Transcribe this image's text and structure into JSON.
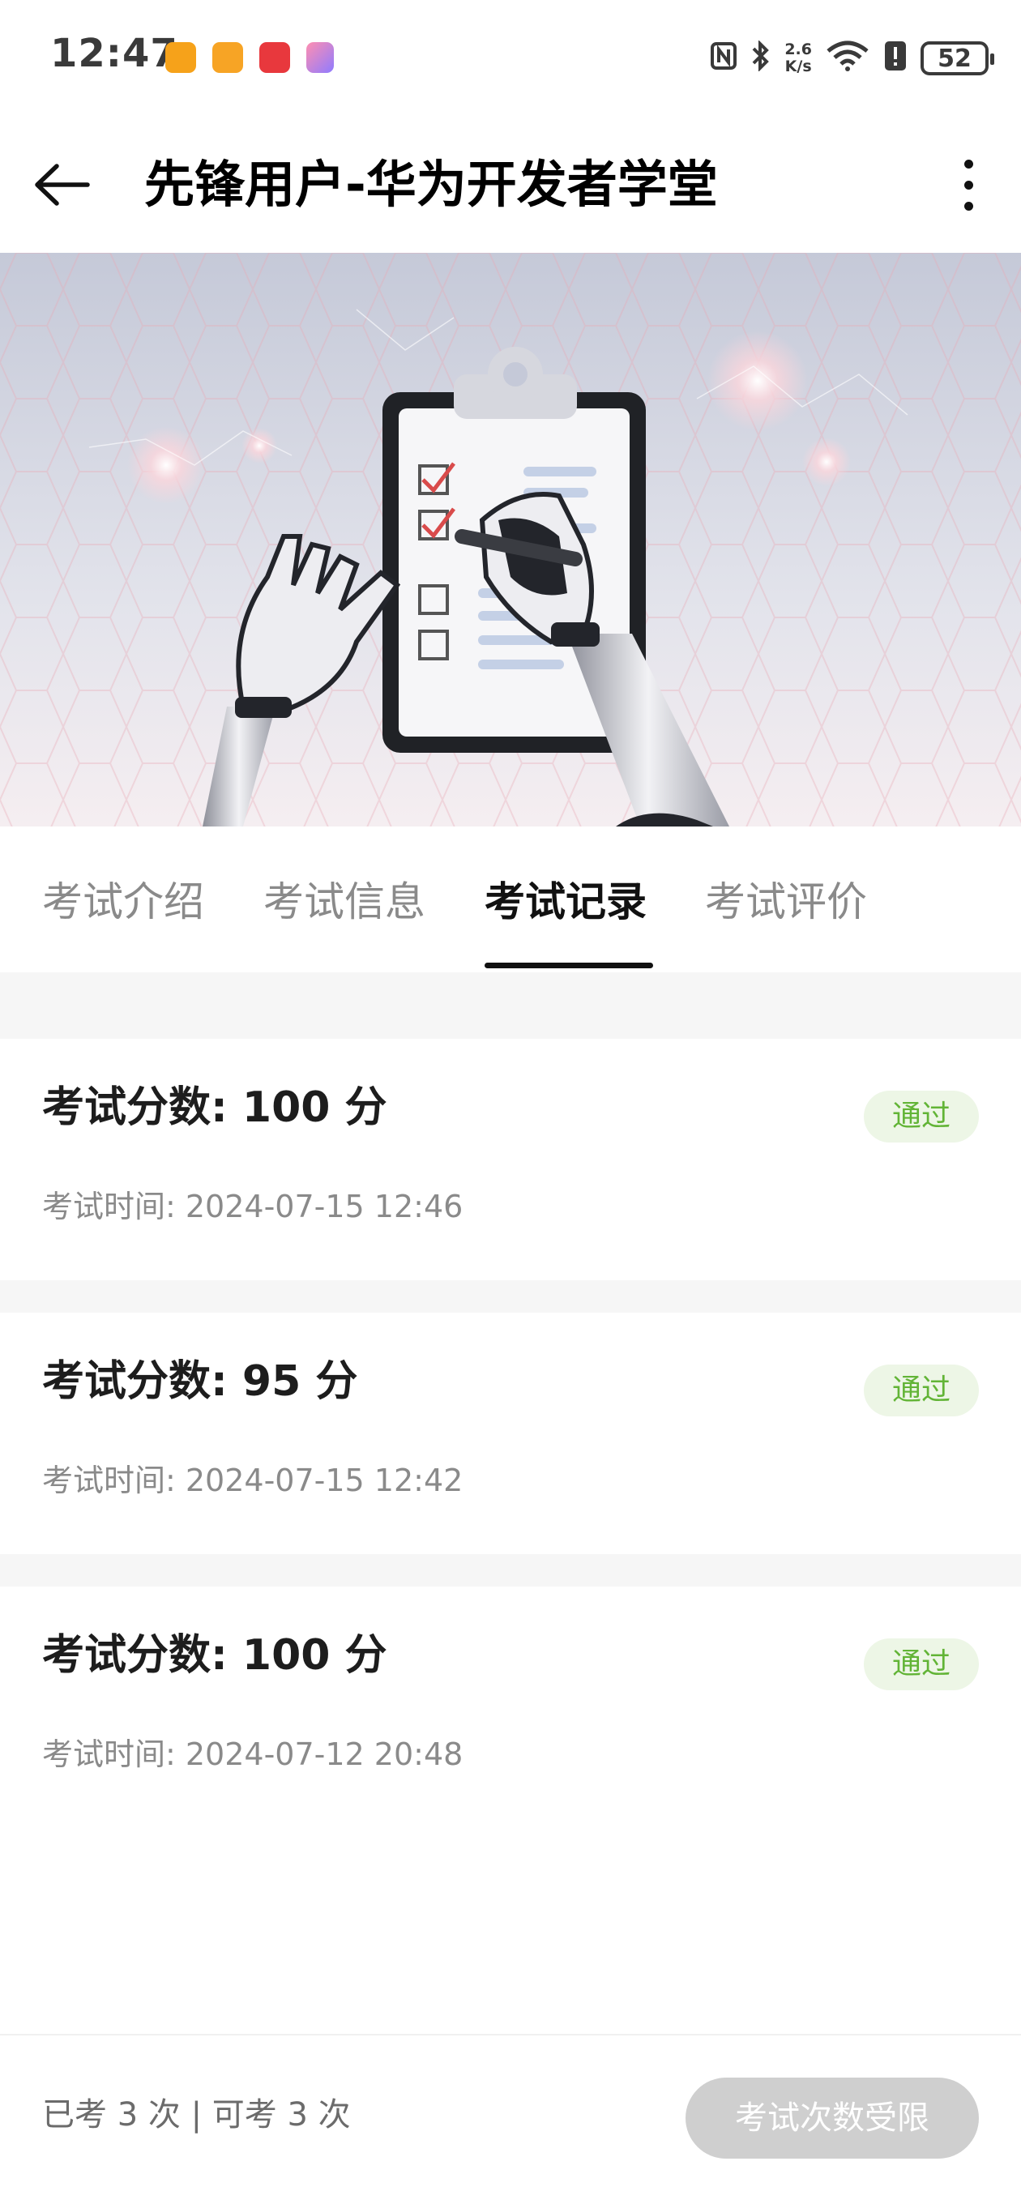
{
  "status_bar": {
    "time": "12:47",
    "net_speed_value": "2.6",
    "net_speed_unit": "K/s",
    "battery": "52",
    "icons": [
      "nfc-icon",
      "bluetooth-icon",
      "wifi-6-icon",
      "battery-alert-icon"
    ]
  },
  "header": {
    "title": "先锋用户-华为开发者学堂"
  },
  "tabs": [
    {
      "label": "考试介绍"
    },
    {
      "label": "考试信息"
    },
    {
      "label": "考试记录"
    },
    {
      "label": "考试评价"
    }
  ],
  "active_tab": "考试记录",
  "records": [
    {
      "score": "考试分数: 100 分",
      "time": "考试时间: 2024-07-15 12:46",
      "status": "通过"
    },
    {
      "score": "考试分数: 95 分",
      "time": "考试时间: 2024-07-15 12:42",
      "status": "通过"
    },
    {
      "score": "考试分数: 100 分",
      "time": "考试时间: 2024-07-12 20:48",
      "status": "通过"
    }
  ],
  "footer": {
    "attempts": "已考 3 次 | 可考 3 次",
    "action_label": "考试次数受限"
  },
  "colors": {
    "pass_text": "#62b436",
    "pass_bg": "#edf6e6",
    "disabled_button": "#cfcfcf"
  }
}
